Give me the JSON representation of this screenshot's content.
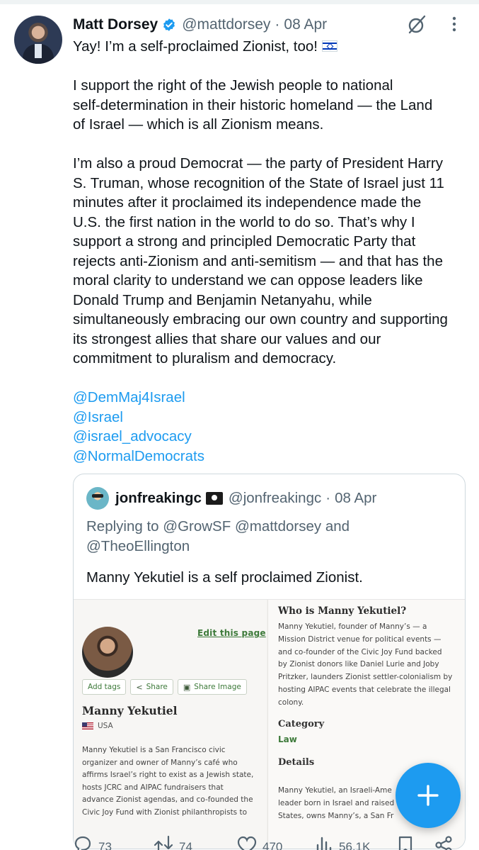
{
  "tweet": {
    "author_name": "Matt Dorsey",
    "handle": "@mattdorsey",
    "separator": "·",
    "date": "08 Apr",
    "first_line": "Yay! I’m a self-proclaimed Zionist, too!",
    "paragraph_1": "I support the right of the Jewish people to national\nself-determination in their historic homeland — the Land\nof Israel — which is all Zionism means.",
    "paragraph_2": "I’m also a proud Democrat — the party of President Harry\nS. Truman, whose recognition of the State of Israel just 11\nminutes after it proclaimed its independence made the\nU.S. the first nation in the world to do so. That’s why I\nsupport a strong and principled Democratic Party that\nrejects anti-Zionism and anti-semitism — and that has the\nmoral clarity to understand we can oppose leaders like\nDonald Trump and Benjamin Netanyahu, while\nsimultaneously embracing our own country and supporting\nits strongest allies that share our values and our\ncommitment to pluralism and democracy.",
    "mentions": [
      "@DemMaj4Israel",
      "@Israel",
      "@israel_advocacy",
      "@NormalDemocrats"
    ]
  },
  "quote": {
    "author_name": "jonfreakingc",
    "handle": "@jonfreakingc",
    "separator": "·",
    "date": "08 Apr",
    "replying_prefix": "Replying to ",
    "replying_to_1": "@GrowSF",
    "replying_to_2": "@mattdorsey",
    "replying_and": " and",
    "replying_to_3": "@TheoEllington",
    "text": "Manny Yekutiel is a self proclaimed Zionist.",
    "image": {
      "edit_link": "Edit this page",
      "buttons": {
        "add_tags": "Add tags",
        "share": "Share",
        "share_image": "Share Image"
      },
      "person_name": "Manny Yekutiel",
      "country": "USA",
      "bio": "Manny Yekutiel is a San Francisco civic\norganizer and owner of Manny’s café who\naffirms Israel’s right to exist as a Jewish state,\nhosts JCRC and AIPAC fundraisers that\nadvance Zionist agendas, and co-founded the\nCivic Joy Fund with Zionist philanthropists to",
      "who_title": "Who is Manny Yekutiel?",
      "who_text": "Manny Yekutiel, founder of Manny’s — a\nMission District venue for political events —\nand co-founder of the Civic Joy Fund backed\nby Zionist donors like Daniel Lurie and Joby\nPritzker, launders Zionist settler-colonialism by\nhosting AIPAC events that celebrate the illegal\ncolony.",
      "category_label": "Category",
      "category_value": "Law",
      "details_label": "Details",
      "details_text": "Manny Yekutiel, an Israeli-Ame\nleader born in Israel and raised\nStates, owns Manny’s, a San Fr"
    }
  },
  "actions": {
    "replies": "73",
    "reposts": "74",
    "likes": "470",
    "views": "56.1K"
  },
  "colors": {
    "accent": "#1d9bf0",
    "text": "#0f1419",
    "secondary": "#536471",
    "green_link": "#3d7a3a"
  },
  "icons": [
    "verified-badge-icon",
    "grok-icon",
    "more-icon",
    "israel-flag-icon",
    "pirate-flag-icon",
    "reply-icon",
    "repost-icon",
    "like-icon",
    "views-icon",
    "bookmark-icon",
    "share-icon",
    "compose-plus-icon"
  ]
}
